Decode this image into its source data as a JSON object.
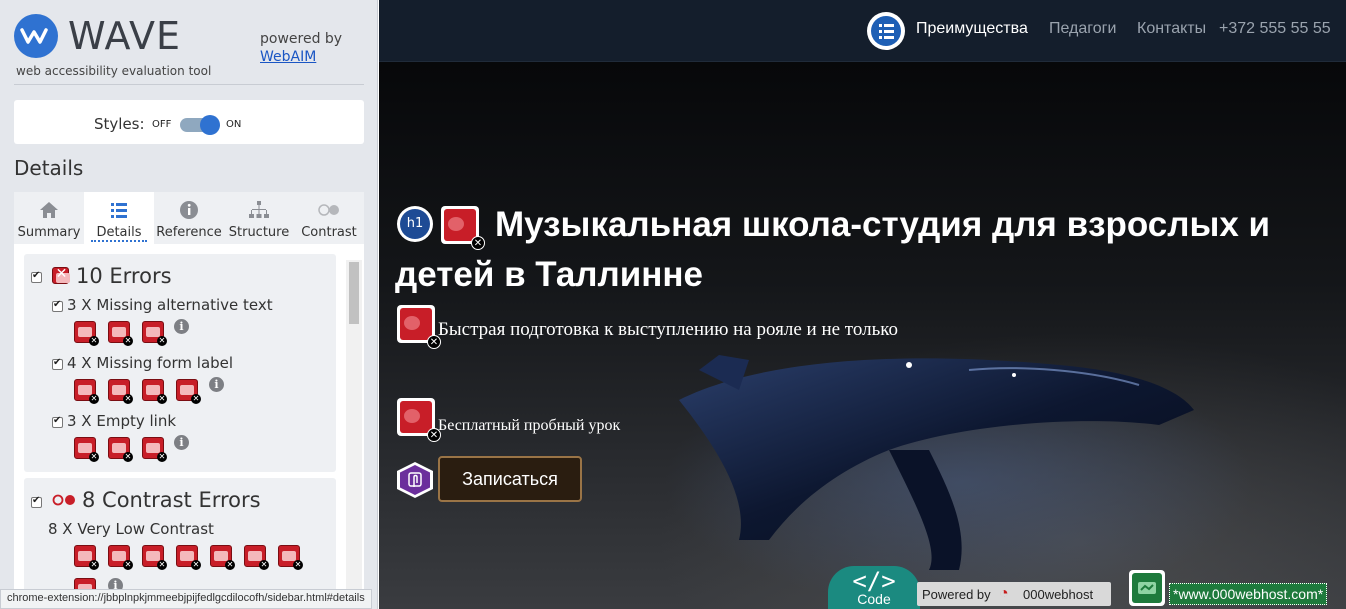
{
  "wave": {
    "title": "WAVE",
    "subtitle": "web accessibility evaluation tool",
    "powered_by": "powered by",
    "webaim": "WebAIM",
    "styles_label": "Styles:",
    "toggle_off": "OFF",
    "toggle_on": "ON",
    "toggle_state": "on",
    "details_heading": "Details",
    "tabs": [
      {
        "label": "Summary",
        "icon": "home-icon"
      },
      {
        "label": "Details",
        "icon": "list-icon",
        "active": true
      },
      {
        "label": "Reference",
        "icon": "info-icon"
      },
      {
        "label": "Structure",
        "icon": "hierarchy-icon"
      },
      {
        "label": "Contrast",
        "icon": "contrast-icon"
      }
    ],
    "errors": {
      "title": "10 Errors",
      "items": [
        {
          "label": "3 X Missing alternative text",
          "count": 3,
          "icon": "missing-alt-icon"
        },
        {
          "label": "4 X Missing form label",
          "count": 4,
          "icon": "missing-label-icon"
        },
        {
          "label": "3 X Empty link",
          "count": 3,
          "icon": "empty-link-icon"
        }
      ]
    },
    "contrast": {
      "title": "8 Contrast Errors",
      "items": [
        {
          "label": "8 X Very Low Contrast",
          "count": 8,
          "icon": "contrast-error-icon"
        }
      ]
    },
    "status_url": "chrome-extension://jbbplnpkjmmeebjpijfedlgcdilocofh/sidebar.html#details",
    "colors": {
      "error": "#c81e28",
      "accent": "#2f72d1"
    }
  },
  "site": {
    "nav": {
      "links": [
        "Преимущества",
        "Педагоги",
        "Контакты",
        "+372 555 55 55"
      ]
    },
    "h1_badge": "h1",
    "hero_title": "Музыкальная школа-студия для взрослых и детей в Таллинне",
    "hero_subtitle": "Быстрая подготовка к выступлению на рояле и не только",
    "free_lesson": "Бесплатный пробный урок",
    "cta": "Записаться",
    "code_badge": {
      "glyph": "</>",
      "label": "Code"
    },
    "powered": {
      "label": "Powered by",
      "brand": "000webhost"
    },
    "footer_link": "*www.000webhost.com*"
  }
}
